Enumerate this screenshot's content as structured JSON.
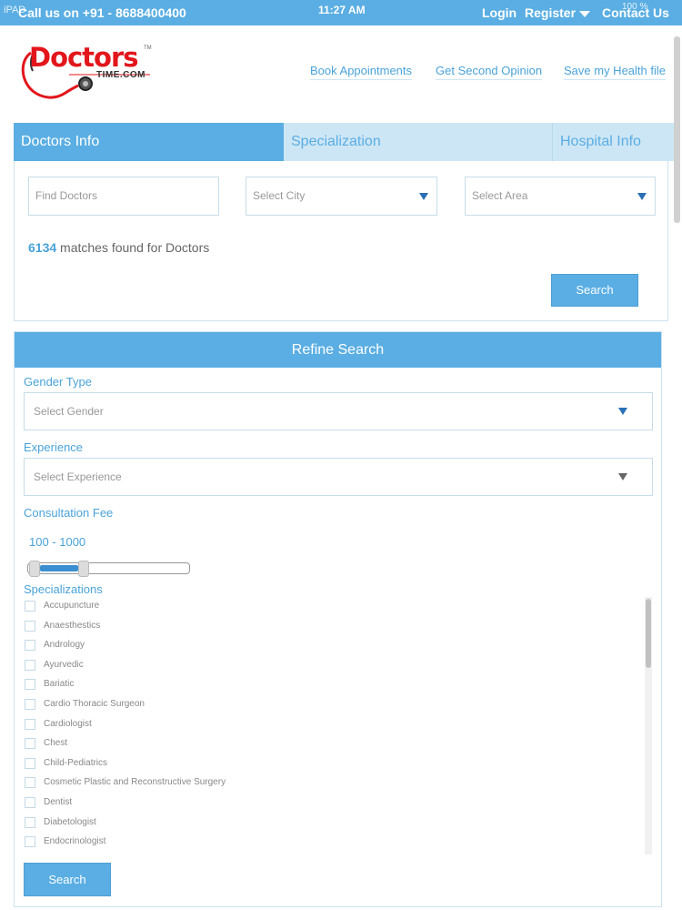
{
  "status": {
    "carrier": "iPAD",
    "time": "11:27 AM",
    "battery": "100 %"
  },
  "topbar": {
    "call": "Call us on +91 - 8688400400",
    "login": "Login",
    "register": "Register",
    "contact": "Contact Us"
  },
  "logo": {
    "word": "Doctors",
    "sub": "TIME.COM",
    "tm": "TM"
  },
  "nav": {
    "book": "Book Appointments",
    "second": "Get Second Opinion",
    "health": "Save my Health file"
  },
  "tabs": [
    "Doctors Info",
    "Specialization",
    "Hospital Info"
  ],
  "search": {
    "doctor_placeholder": "Find Doctors",
    "city": "Select City",
    "area": "Select Area",
    "matches_count": "6134",
    "matches_text": " matches found for Doctors",
    "button": "Search"
  },
  "refine": {
    "title": "Refine Search",
    "gender_label": "Gender Type",
    "gender_value": "Select Gender",
    "experience_label": "Experience",
    "experience_value": "Select Experience",
    "fee_label": "Consultation Fee",
    "fee_value": "100 - 1000",
    "fee_range": {
      "min": 100,
      "max": 1000,
      "slider_start_fraction": 0.0,
      "slider_end_fraction": 0.32
    },
    "spec_label": "Specializations",
    "specializations": [
      "Accupuncture",
      "Anaesthestics",
      "Andrology",
      "Ayurvedic",
      "Bariatic",
      "Cardio Thoracic Surgeon",
      "Cardiologist",
      "Chest",
      "Child-Pediatrics",
      "Cosmetic Plastic and Reconstructive Surgery",
      "Dentist",
      "Diabetologist",
      "Endocrinologist"
    ],
    "button": "Search"
  },
  "colors": {
    "accent": "#5aaee3",
    "link": "#4aa3d8",
    "brand_red": "#e2161b"
  }
}
